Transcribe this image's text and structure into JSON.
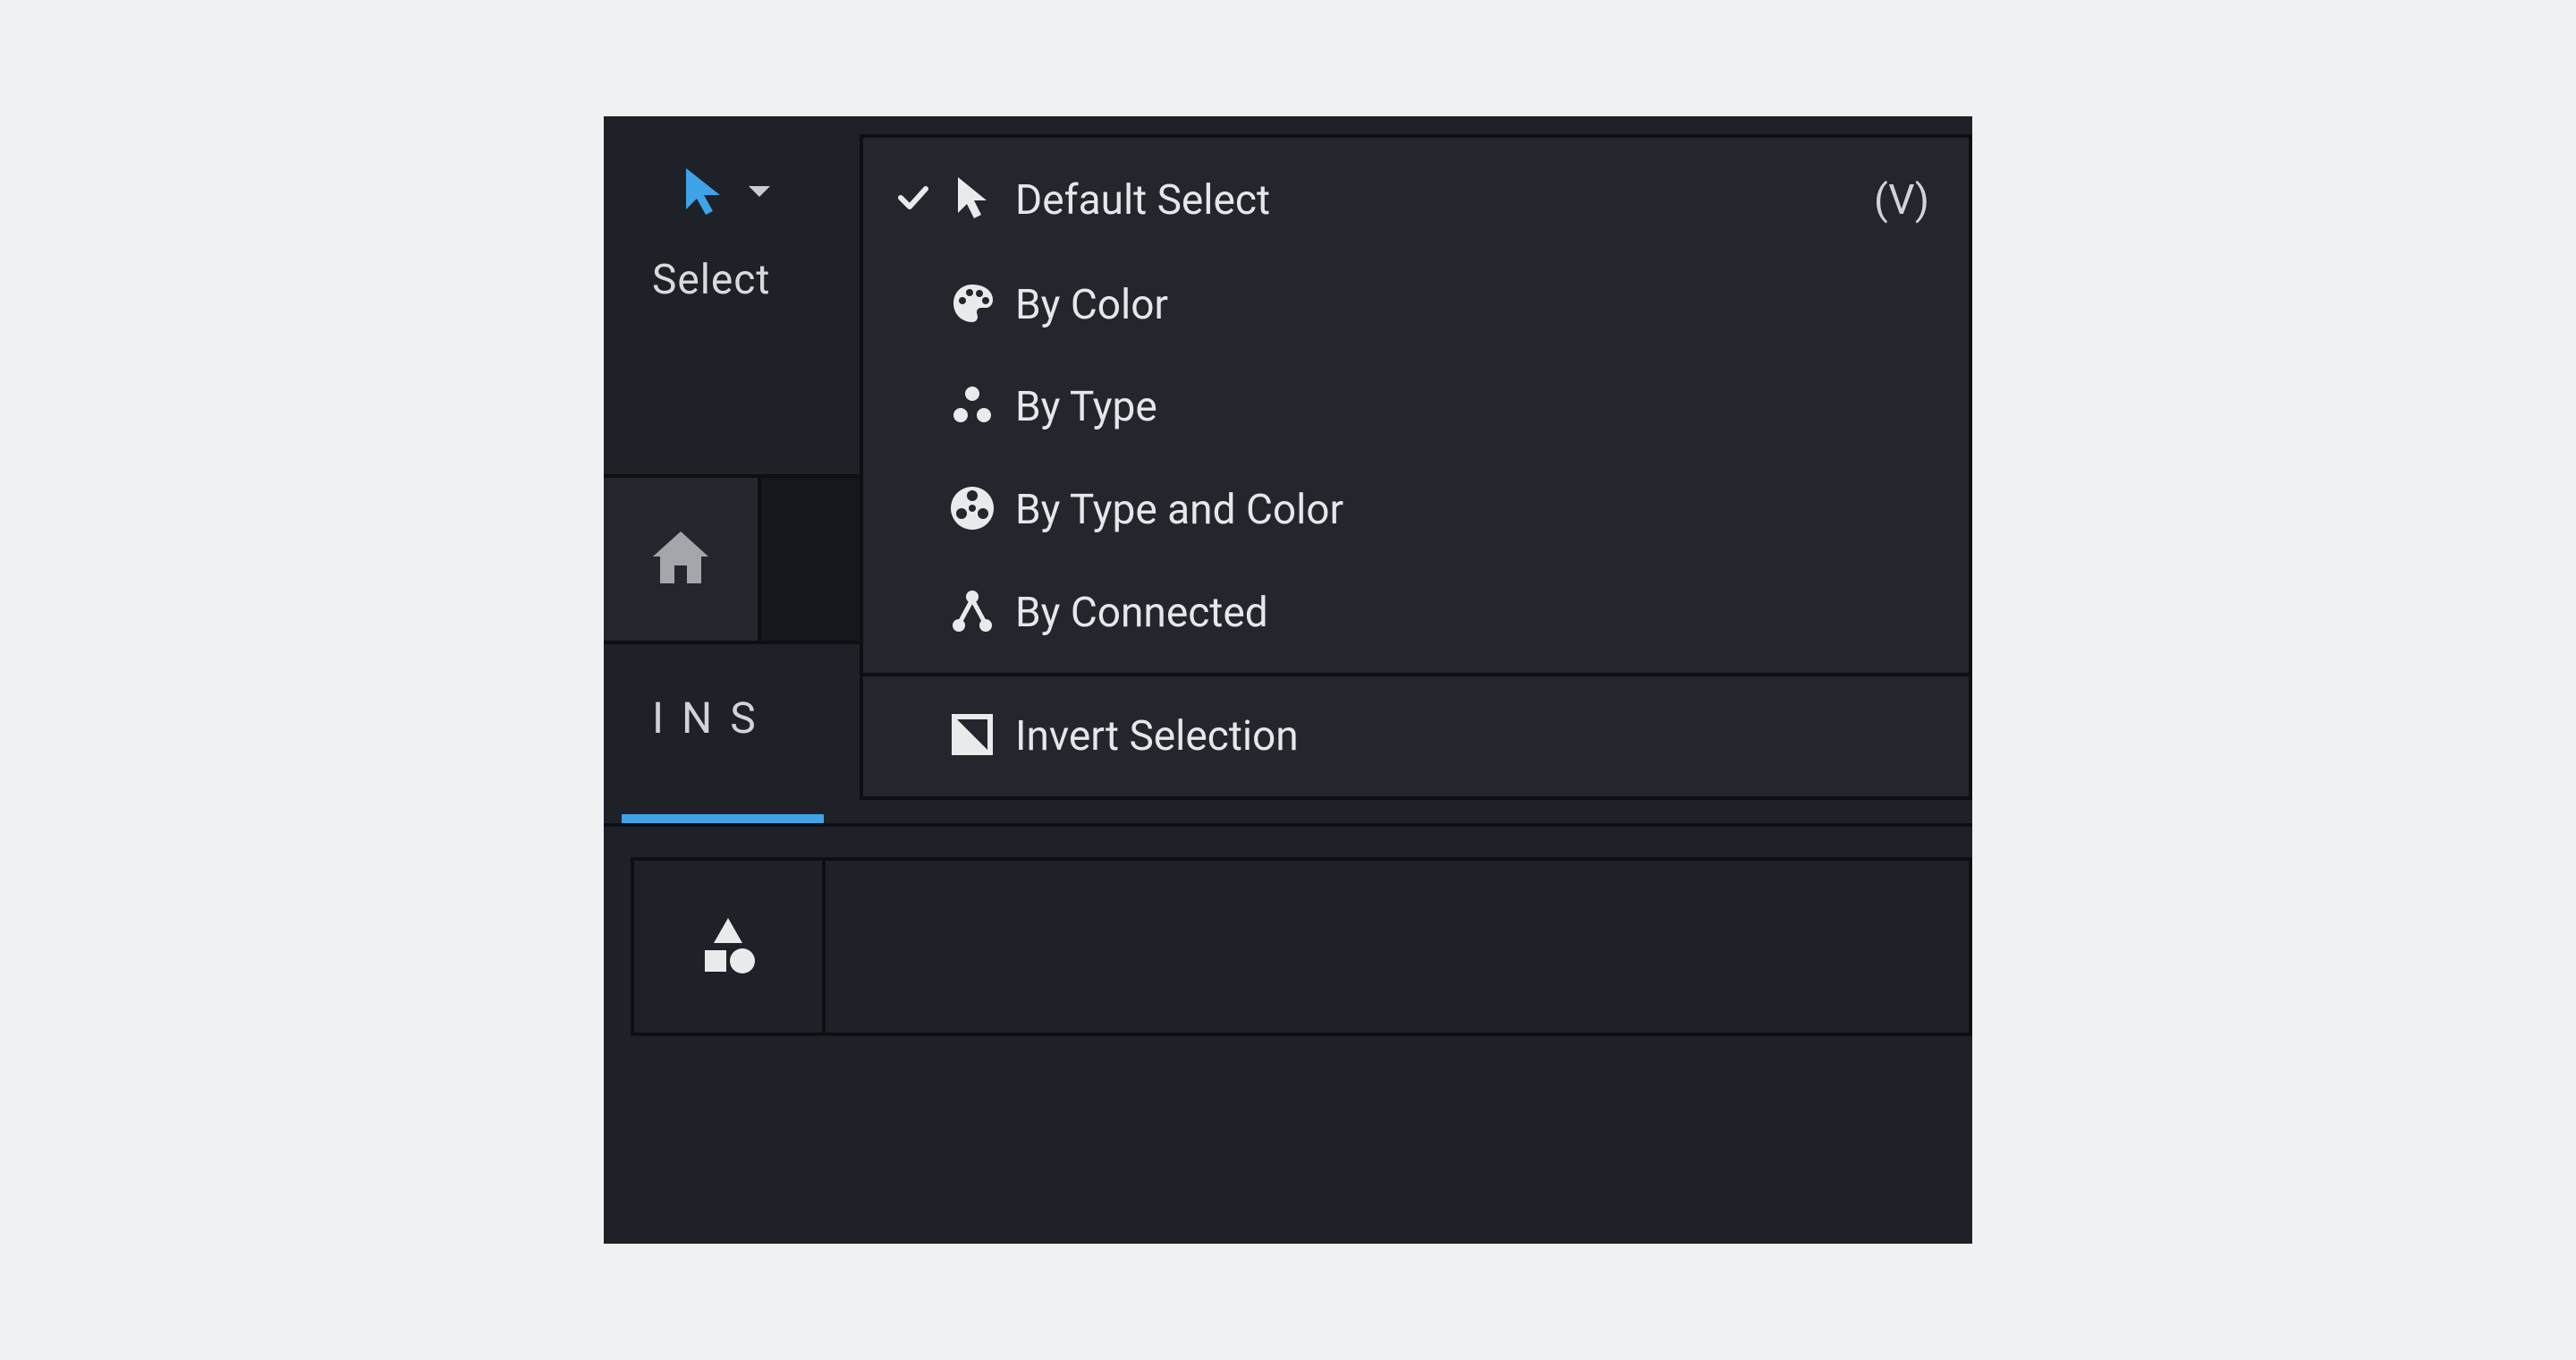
{
  "toolbar": {
    "select_label": "Select"
  },
  "tabs": {
    "tab1_label": "INS"
  },
  "menu": {
    "items": [
      {
        "label": "Default Select",
        "shortcut": "(V)",
        "icon": "cursor",
        "checked": true
      },
      {
        "label": "By Color",
        "shortcut": "",
        "icon": "palette",
        "checked": false
      },
      {
        "label": "By Type",
        "shortcut": "",
        "icon": "dots-triangle",
        "checked": false
      },
      {
        "label": "By Type and Color",
        "shortcut": "",
        "icon": "reel",
        "checked": false
      },
      {
        "label": "By Connected",
        "shortcut": "",
        "icon": "connected",
        "checked": false
      }
    ],
    "footer": {
      "label": "Invert Selection",
      "icon": "invert"
    }
  },
  "colors": {
    "accent": "#3fa3e8",
    "panel_bg": "#1e2128",
    "menu_bg": "#23262d",
    "border": "#0e0f12",
    "text": "#e5e7ea"
  }
}
